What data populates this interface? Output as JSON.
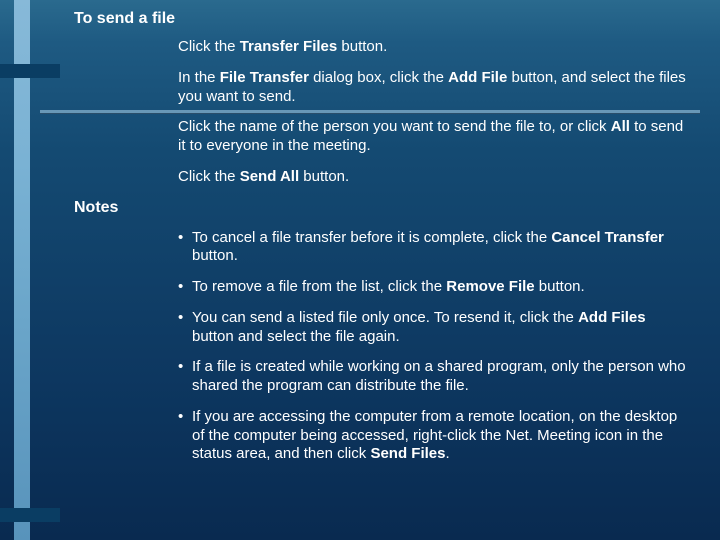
{
  "heading": "To send a file",
  "steps": [
    {
      "pre": "Click the ",
      "bold": "Transfer Files",
      "post": " button."
    },
    {
      "parts": [
        {
          "t": "In the "
        },
        {
          "b": "File Transfer"
        },
        {
          "t": " dialog box, click the "
        },
        {
          "b": "Add File"
        },
        {
          "t": " button, and select the files you want to send."
        }
      ]
    },
    {
      "parts": [
        {
          "t": "Click the name of the person you want to send the file to, or click "
        },
        {
          "b": "All"
        },
        {
          "t": " to send it to everyone in the meeting."
        }
      ]
    },
    {
      "pre": "Click the ",
      "bold": "Send All",
      "post": " button."
    }
  ],
  "notesHeading": "Notes",
  "notes": [
    {
      "parts": [
        {
          "t": "To cancel a file transfer before it is complete, click the "
        },
        {
          "b": "Cancel Transfer"
        },
        {
          "t": " button."
        }
      ]
    },
    {
      "parts": [
        {
          "t": "To remove a file from the list, click the "
        },
        {
          "b": "Remove File"
        },
        {
          "t": " button."
        }
      ]
    },
    {
      "parts": [
        {
          "t": "You can send a listed file only once. To resend it, click the "
        },
        {
          "b": "Add Files"
        },
        {
          "t": " button and select the file again."
        }
      ]
    },
    {
      "parts": [
        {
          "t": "If a file is created while working on a shared program, only the person who shared the program can distribute the file."
        }
      ]
    },
    {
      "parts": [
        {
          "t": "If you are accessing the computer from a remote location, on the desktop of the computer being accessed, right-click the Net. Meeting icon in the status area, and then click "
        },
        {
          "b": "Send Files"
        },
        {
          "t": "."
        }
      ]
    }
  ]
}
